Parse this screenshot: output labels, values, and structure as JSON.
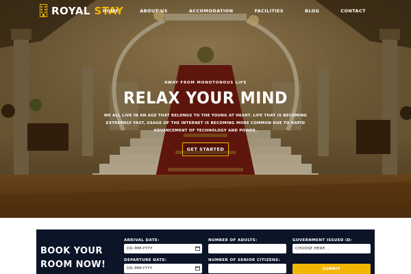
{
  "brand": {
    "name_part1": "ROYAL",
    "name_part2": "STAY",
    "accent_color": "#f2b705"
  },
  "nav": {
    "items": [
      {
        "label": "HOME"
      },
      {
        "label": "ABOUT US"
      },
      {
        "label": "ACCOMODATION"
      },
      {
        "label": "FACILITIES"
      },
      {
        "label": "BLOG"
      },
      {
        "label": "CONTACT"
      }
    ]
  },
  "hero": {
    "eyebrow": "AWAY FROM MONOTONOUS LIFE",
    "headline": "RELAX YOUR MIND",
    "subcopy": "WE ALL LIVE IN AN AGE THAT BELONGS TO THE YOUNG AT HEART. LIFE THAT IS BECOMING EXTREMELY FAST, USAGE OF THE INTERNET IS BECOMING MORE COMMON DUE TO RAPID ADVANCEMENT OF TECHNOLOGY AND POWER.",
    "cta_label": "GET STARTED"
  },
  "booking": {
    "title": "BOOK YOUR ROOM NOW!",
    "arrival_label": "ARRIVAL DATE:",
    "arrival_value": "DD-MM-YYYY",
    "departure_label": "DEPARTURE DATE:",
    "departure_value": "DD-MM-YYYY",
    "adults_label": "NUMBER OF ADULTS:",
    "adults_value": "",
    "seniors_label": "NUMBER OF SENIOR CITIZENS:",
    "seniors_value": "",
    "id_label": "GOVERNMENT ISSUED ID:",
    "id_value": "CHOOSE HERE...",
    "submit_label": "SUBMIT",
    "panel_color": "#0c1427"
  }
}
